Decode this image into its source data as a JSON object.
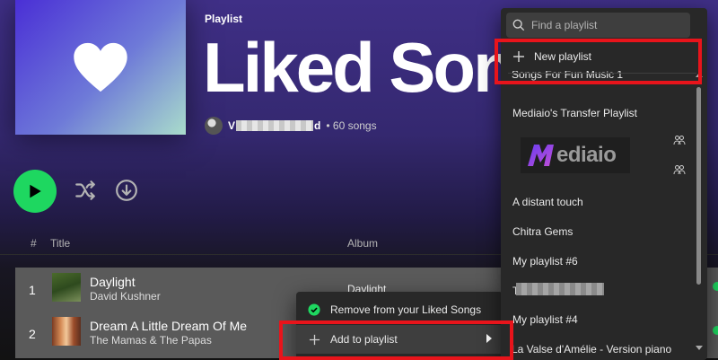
{
  "header": {
    "kind": "Playlist",
    "title": "Liked Songs",
    "owner_initial": "V",
    "owner_suffix": "d",
    "song_count": "• 60 songs"
  },
  "table": {
    "columns": {
      "num": "#",
      "title": "Title",
      "album": "Album"
    },
    "rows": [
      {
        "index": "1",
        "title": "Daylight",
        "artist": "David Kushner",
        "album": "Daylight"
      },
      {
        "index": "2",
        "title": "Dream A Little Dream Of Me",
        "artist": "The Mamas & The Papas",
        "album": ""
      }
    ]
  },
  "context_menu": {
    "remove_label": "Remove from your Liked Songs",
    "add_label": "Add to playlist"
  },
  "submenu": {
    "search_placeholder": "Find a playlist",
    "new_playlist_label": "New playlist",
    "partial_item": "Songs For Fun Music 1",
    "playlists": [
      "Mediaio's Transfer Playlist",
      "A distant touch",
      "Chitra Gems",
      "My playlist #6",
      "T",
      "My playlist #4",
      "La Valse d'Amélie - Version piano"
    ],
    "logo_text": "ediaio"
  },
  "colors": {
    "accent_green": "#1ed760",
    "highlight_red": "#e8141b",
    "menu_bg": "#282828"
  },
  "icons": [
    "heart-icon",
    "play-icon",
    "shuffle-icon",
    "download-icon",
    "check-circle-icon",
    "plus-icon",
    "chevron-right-icon",
    "search-icon",
    "collaborator-icon"
  ]
}
